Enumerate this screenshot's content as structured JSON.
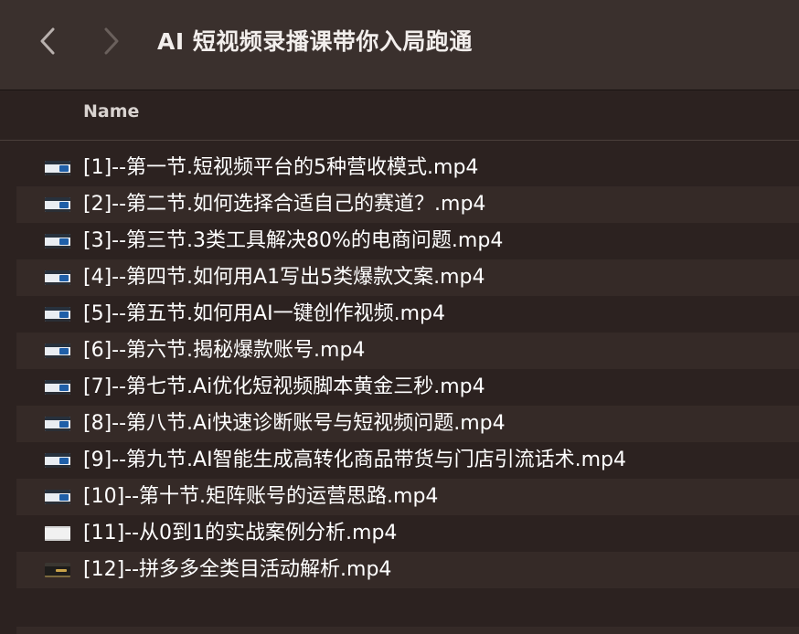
{
  "window": {
    "title": "AI 短视频录播课带你入局跑通"
  },
  "nav": {
    "back_icon": "chevron-left-icon",
    "forward_icon": "chevron-right-icon"
  },
  "columns": {
    "name": "Name"
  },
  "files": [
    {
      "name": "[1]--第一节.短视频平台的5种营收模式.mp4",
      "thumb": "video-thumbnail-icon"
    },
    {
      "name": "[2]--第二节.如何选择合适自己的赛道？.mp4",
      "thumb": "video-thumbnail-icon"
    },
    {
      "name": "[3]--第三节.3类工具解决80%的电商问题.mp4",
      "thumb": "video-thumbnail-icon"
    },
    {
      "name": "[4]--第四节.如何用A1写出5类爆款文案.mp4",
      "thumb": "video-thumbnail-icon"
    },
    {
      "name": "[5]--第五节.如何用AI一键创作视频.mp4",
      "thumb": "video-thumbnail-icon"
    },
    {
      "name": "[6]--第六节.揭秘爆款账号.mp4",
      "thumb": "video-thumbnail-icon"
    },
    {
      "name": "[7]--第七节.Ai优化短视频脚本黄金三秒.mp4",
      "thumb": "video-thumbnail-icon"
    },
    {
      "name": "[8]--第八节.Ai快速诊断账号与短视频问题.mp4",
      "thumb": "video-thumbnail-icon"
    },
    {
      "name": "[9]--第九节.AI智能生成高转化商品带货与门店引流话术.mp4",
      "thumb": "video-thumbnail-icon"
    },
    {
      "name": "[10]--第十节.矩阵账号的运营思路.mp4",
      "thumb": "video-thumbnail-icon"
    },
    {
      "name": "[11]--从0到1的实战案例分析.mp4",
      "thumb": "video-thumbnail-icon"
    },
    {
      "name": "[12]--拼多多全类目活动解析.mp4",
      "thumb": "video-thumbnail-icon"
    }
  ],
  "colors": {
    "background": "#2c2220",
    "toolbar": "#3a302d",
    "row_alt": "#352a27",
    "text": "#ffffff"
  }
}
